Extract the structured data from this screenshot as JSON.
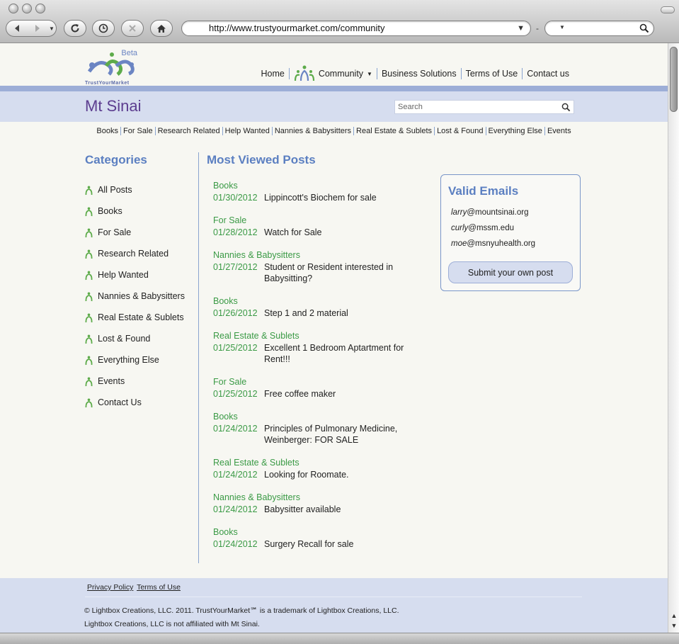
{
  "browser": {
    "url": "http://www.trustyourmarket.com/community"
  },
  "logo": {
    "beta": "Beta",
    "brand": "TrustYourMarket"
  },
  "topnav": {
    "home": "Home",
    "community": "Community",
    "business": "Business Solutions",
    "terms": "Terms of Use",
    "contact": "Contact us"
  },
  "site": {
    "title": "Mt Sinai",
    "search_placeholder": "Search"
  },
  "subnav": [
    "Books",
    "For Sale",
    "Research Related",
    "Help Wanted",
    "Nannies & Babysitters",
    "Real Estate & Sublets",
    "Lost & Found",
    "Everything Else",
    "Events"
  ],
  "categories": {
    "title": "Categories",
    "items": [
      "All Posts",
      "Books",
      "For Sale",
      "Research Related",
      "Help Wanted",
      "Nannies & Babysitters",
      "Real Estate & Sublets",
      "Lost & Found",
      "Everything Else",
      "Events",
      "Contact Us"
    ]
  },
  "posts": {
    "title": "Most Viewed Posts",
    "items": [
      {
        "category": "Books",
        "date": "01/30/2012",
        "title": "Lippincott's Biochem for sale"
      },
      {
        "category": "For Sale",
        "date": "01/28/2012",
        "title": "Watch for Sale"
      },
      {
        "category": "Nannies & Babysitters",
        "date": "01/27/2012",
        "title": "Student or Resident interested in Babysitting?"
      },
      {
        "category": "Books",
        "date": "01/26/2012",
        "title": "Step 1 and 2 material"
      },
      {
        "category": "Real Estate & Sublets",
        "date": "01/25/2012",
        "title": "Excellent 1 Bedroom Aptartment for Rent!!!"
      },
      {
        "category": "For Sale",
        "date": "01/25/2012",
        "title": "Free coffee maker"
      },
      {
        "category": "Books",
        "date": "01/24/2012",
        "title": "Principles of Pulmonary Medicine, Weinberger: FOR SALE"
      },
      {
        "category": "Real Estate & Sublets",
        "date": "01/24/2012",
        "title": "Looking for Roomate."
      },
      {
        "category": "Nannies & Babysitters",
        "date": "01/24/2012",
        "title": "Babysitter available"
      },
      {
        "category": "Books",
        "date": "01/24/2012",
        "title": "Surgery Recall for sale"
      }
    ]
  },
  "emails": {
    "title": "Valid Emails",
    "items": [
      {
        "user": "larry",
        "domain": "@mountsinai.org"
      },
      {
        "user": "curly",
        "domain": "@mssm.edu"
      },
      {
        "user": "moe",
        "domain": "@msnyuhealth.org"
      }
    ],
    "submit_label": "Submit your own post"
  },
  "footer": {
    "privacy": "Privacy Policy",
    "terms": "Terms of Use",
    "copyright": "© Lightbox Creations, LLC. 2011. TrustYourMarket℠ is a trademark of Lightbox Creations, LLC.",
    "disclaimer": "Lightbox Creations, LLC is not affiliated with Mt Sinai."
  },
  "colors": {
    "accent_blue": "#5b7fc1",
    "accent_green": "#3a9a45",
    "title_purple": "#5c3d8f",
    "band": "#d6ddef"
  }
}
